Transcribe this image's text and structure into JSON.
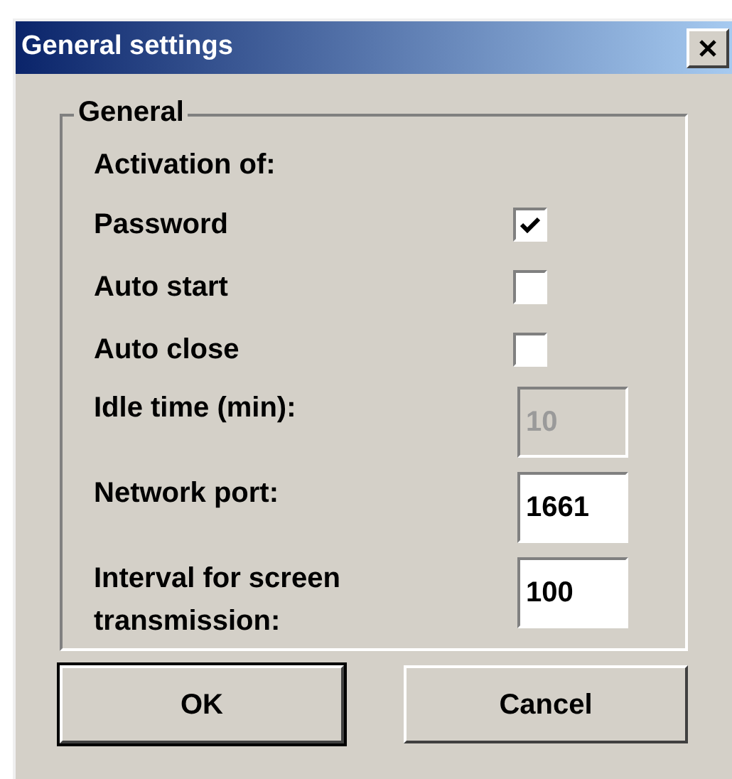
{
  "window": {
    "title": "General settings"
  },
  "group": {
    "title": "General",
    "heading": "Activation of:"
  },
  "fields": [
    {
      "kind": "checkbox",
      "label": "Password",
      "checked": true
    },
    {
      "kind": "checkbox",
      "label": "Auto start",
      "checked": false
    },
    {
      "kind": "checkbox",
      "label": "Auto close",
      "checked": false
    },
    {
      "kind": "input",
      "label": "Idle time (min):",
      "value": "10",
      "disabled": true
    },
    {
      "kind": "input",
      "label": "Network port:",
      "value": "1661",
      "disabled": false
    },
    {
      "kind": "input",
      "label": "Interval for screen transmission:",
      "value": "100",
      "disabled": false
    }
  ],
  "buttons": [
    {
      "label": "OK",
      "default": true
    },
    {
      "label": "Cancel",
      "default": false
    }
  ]
}
